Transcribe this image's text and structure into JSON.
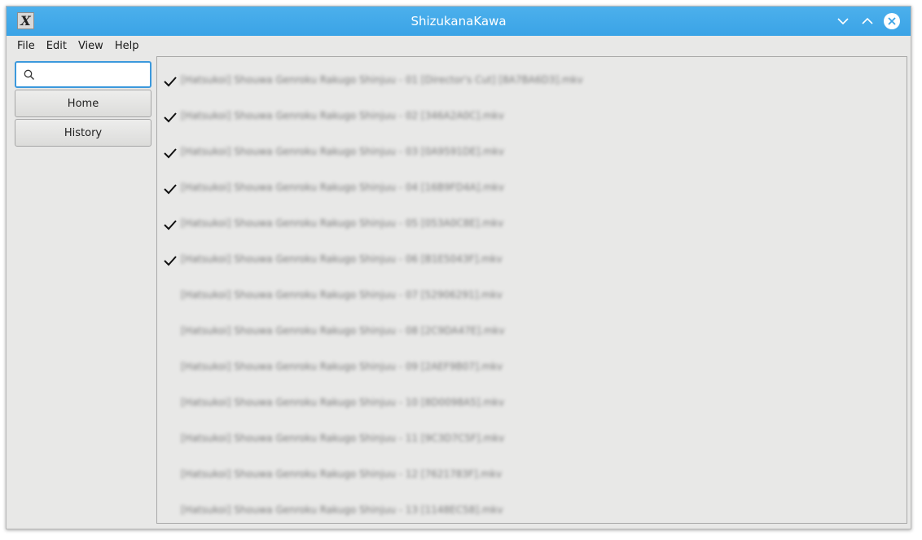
{
  "window": {
    "title": "ShizukanaKawa",
    "app_icon_glyph": "X"
  },
  "menu": {
    "items": [
      "File",
      "Edit",
      "View",
      "Help"
    ]
  },
  "sidebar": {
    "search_placeholder": "",
    "search_value": "",
    "home_label": "Home",
    "history_label": "History"
  },
  "files": [
    {
      "name": "[Hatsukoi] Shouwa Genroku Rakugo Shinjuu - 01 [Director's Cut] [8A7BA6D3].mkv",
      "watched": true
    },
    {
      "name": "[Hatsukoi] Shouwa Genroku Rakugo Shinjuu - 02 [346A2A0C].mkv",
      "watched": true
    },
    {
      "name": "[Hatsukoi] Shouwa Genroku Rakugo Shinjuu - 03 [0A9591DE].mkv",
      "watched": true
    },
    {
      "name": "[Hatsukoi] Shouwa Genroku Rakugo Shinjuu - 04 [16B9FD4A].mkv",
      "watched": true
    },
    {
      "name": "[Hatsukoi] Shouwa Genroku Rakugo Shinjuu - 05 [053A0C8E].mkv",
      "watched": true
    },
    {
      "name": "[Hatsukoi] Shouwa Genroku Rakugo Shinjuu - 06 [B1E5043F].mkv",
      "watched": true
    },
    {
      "name": "[Hatsukoi] Shouwa Genroku Rakugo Shinjuu - 07 [52906291].mkv",
      "watched": false
    },
    {
      "name": "[Hatsukoi] Shouwa Genroku Rakugo Shinjuu - 08 [2C9DA47E].mkv",
      "watched": false
    },
    {
      "name": "[Hatsukoi] Shouwa Genroku Rakugo Shinjuu - 09 [2AEF9B07].mkv",
      "watched": false
    },
    {
      "name": "[Hatsukoi] Shouwa Genroku Rakugo Shinjuu - 10 [8D0098A5].mkv",
      "watched": false
    },
    {
      "name": "[Hatsukoi] Shouwa Genroku Rakugo Shinjuu - 11 [9C3D7C5F].mkv",
      "watched": false
    },
    {
      "name": "[Hatsukoi] Shouwa Genroku Rakugo Shinjuu - 12 [7621783F].mkv",
      "watched": false
    },
    {
      "name": "[Hatsukoi] Shouwa Genroku Rakugo Shinjuu - 13 [1148EC58].mkv",
      "watched": false
    }
  ],
  "icons": {
    "check": "check-icon",
    "search": "search-icon",
    "minimize": "chevron-down-icon",
    "maximize": "chevron-up-icon",
    "close": "close-icon"
  },
  "colors": {
    "titlebar": "#3aa3e6",
    "focus_border": "#3c99dc",
    "background": "#e8e8e7"
  }
}
